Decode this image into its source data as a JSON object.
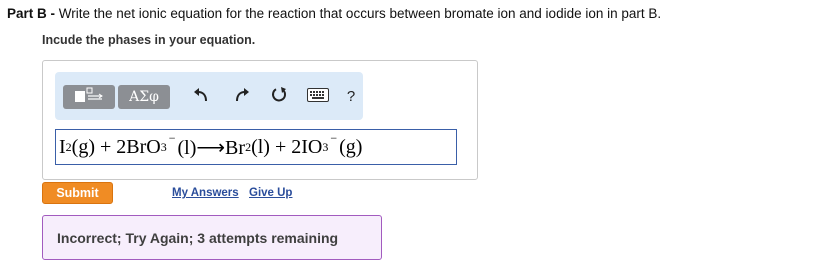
{
  "question": {
    "part_label": "Part B",
    "separator": " - ",
    "prompt": "Write the net ionic equation for the reaction that occurs between bromate ion and iodide ion in part B.",
    "instruction": "Incude the phases in your equation."
  },
  "toolbar": {
    "templates_icon": "templates-icon",
    "greek_label": "ΑΣφ",
    "undo_icon": "undo-icon",
    "redo_icon": "redo-icon",
    "reset_icon": "reset-icon",
    "keyboard_icon": "keyboard-icon",
    "help_label": "?"
  },
  "answer": {
    "t1": "I",
    "s1": "2",
    "t2": " (g) + 2BrO",
    "s2": "3",
    "c1": "−",
    "t3": " (l)⟶Br",
    "s3": "2",
    "t4": " (l) + 2IO",
    "s4": "3",
    "c2": "−",
    "t5": " (g)"
  },
  "actions": {
    "submit_label": "Submit",
    "my_answers_label": "My Answers",
    "give_up_label": "Give Up"
  },
  "feedback": {
    "message": "Incorrect; Try Again; 3 attempts remaining"
  },
  "colors": {
    "submit": "#f08c24",
    "link": "#2a4d9b",
    "feedback_border": "#a25bbf",
    "feedback_bg": "#f7eefc",
    "toolbar_bg": "#dceaf8",
    "answer_border": "#3a5fa8"
  }
}
